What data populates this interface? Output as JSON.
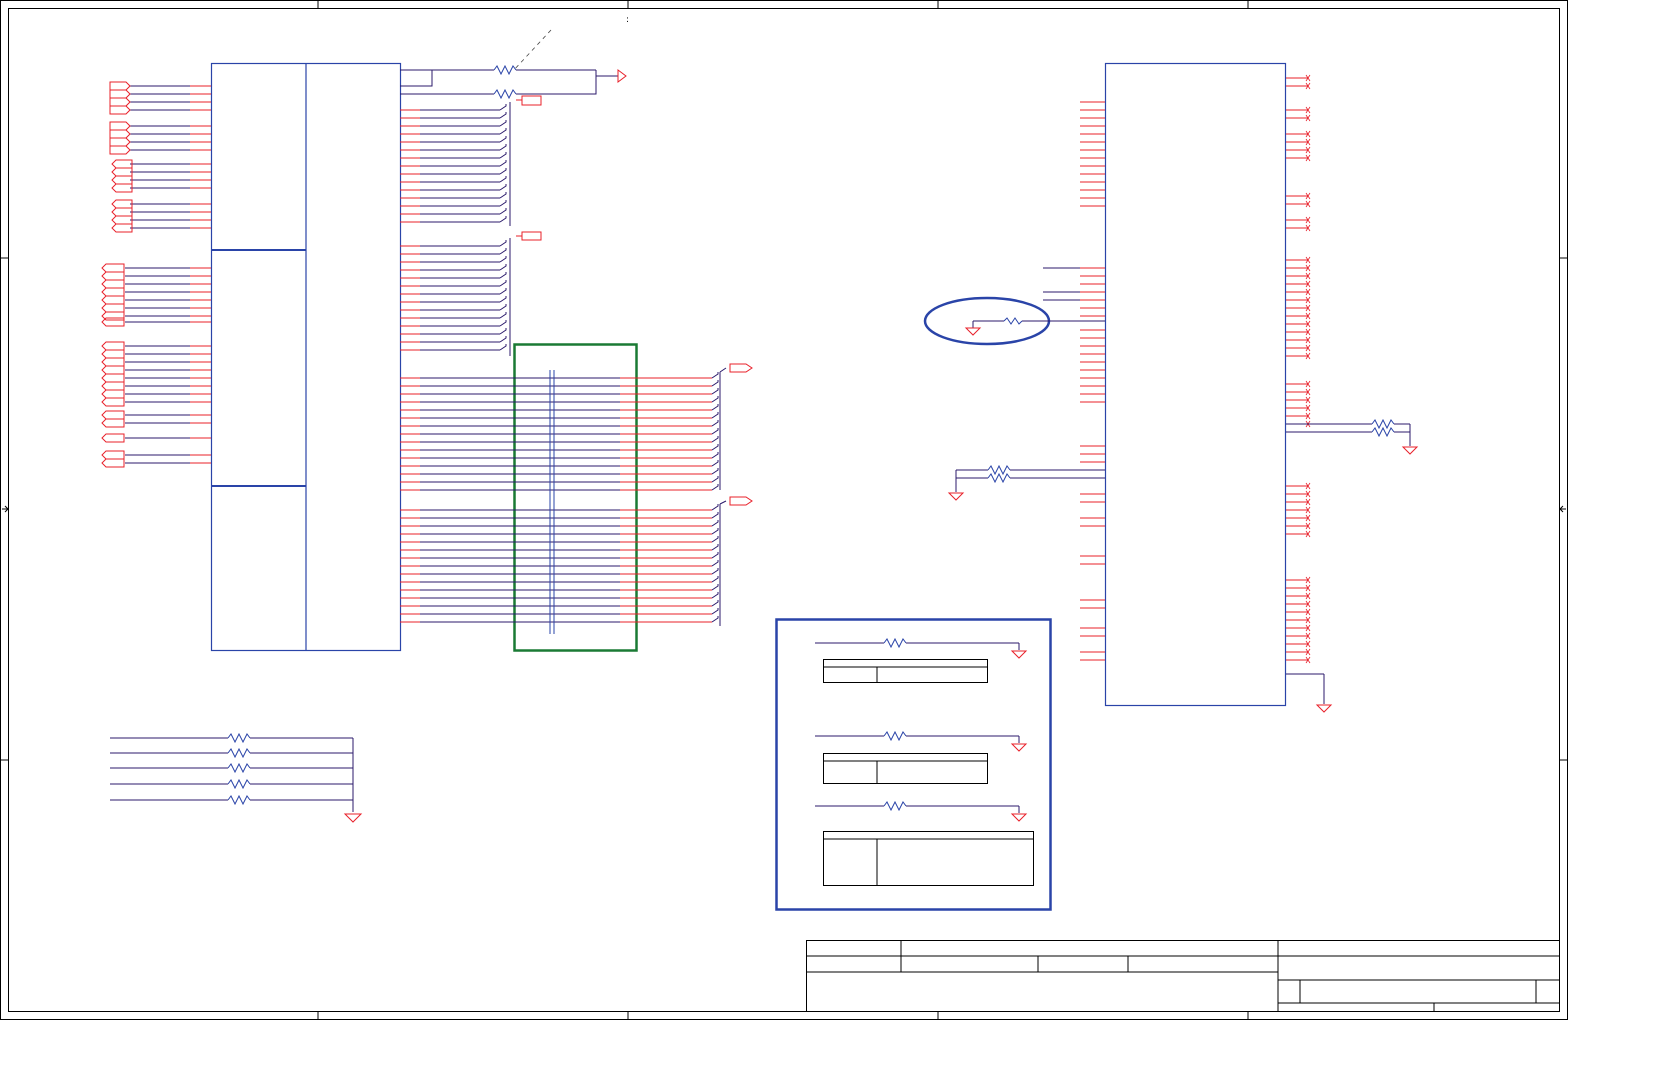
{
  "sheet": {
    "title_block_text": "",
    "annotations": [
      ":"
    ],
    "colors": {
      "wire": "#2b1a6b",
      "pin": "#e8202a",
      "part_outline": "#2a44a8",
      "highlight_box": "#1a7a34",
      "frame": "#000000"
    }
  }
}
